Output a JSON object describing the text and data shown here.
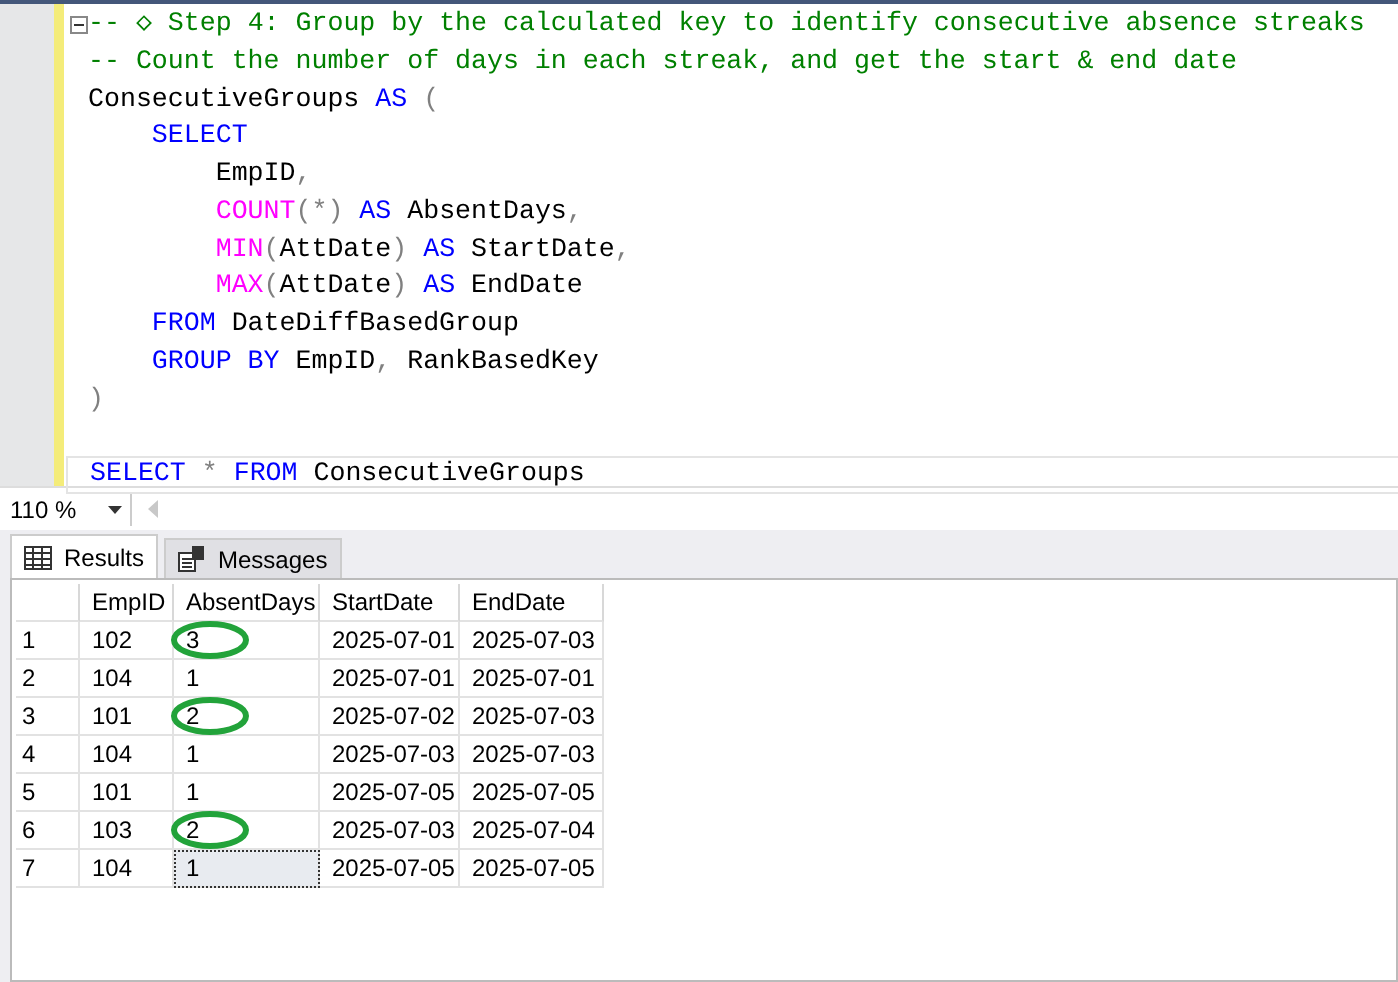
{
  "editor": {
    "lines": [
      {
        "collapsible": true,
        "tokens": [
          {
            "kind": "comment",
            "text": "-- ◇ Step 4: Group by the calculated key to identify consecutive absence streaks"
          }
        ]
      },
      {
        "collapsible": false,
        "tokens": [
          {
            "kind": "comment",
            "text": "-- Count the number of days in each streak, and get the start & end date"
          }
        ]
      },
      {
        "collapsible": false,
        "tokens": [
          {
            "kind": "plain",
            "text": "ConsecutiveGroups "
          },
          {
            "kind": "keyword",
            "text": "AS"
          },
          {
            "kind": "punct",
            "text": " ("
          }
        ]
      },
      {
        "collapsible": false,
        "tokens": [
          {
            "kind": "keyword",
            "text": "    SELECT"
          }
        ]
      },
      {
        "collapsible": false,
        "tokens": [
          {
            "kind": "plain",
            "text": "        EmpID"
          },
          {
            "kind": "punct",
            "text": ","
          }
        ]
      },
      {
        "collapsible": false,
        "tokens": [
          {
            "kind": "function",
            "text": "        COUNT"
          },
          {
            "kind": "punct",
            "text": "(*)"
          },
          {
            "kind": "keyword",
            "text": " AS"
          },
          {
            "kind": "plain",
            "text": " AbsentDays"
          },
          {
            "kind": "punct",
            "text": ","
          }
        ]
      },
      {
        "collapsible": false,
        "tokens": [
          {
            "kind": "function",
            "text": "        MIN"
          },
          {
            "kind": "punct",
            "text": "("
          },
          {
            "kind": "plain",
            "text": "AttDate"
          },
          {
            "kind": "punct",
            "text": ")"
          },
          {
            "kind": "keyword",
            "text": " AS"
          },
          {
            "kind": "plain",
            "text": " StartDate"
          },
          {
            "kind": "punct",
            "text": ","
          }
        ]
      },
      {
        "collapsible": false,
        "tokens": [
          {
            "kind": "function",
            "text": "        MAX"
          },
          {
            "kind": "punct",
            "text": "("
          },
          {
            "kind": "plain",
            "text": "AttDate"
          },
          {
            "kind": "punct",
            "text": ")"
          },
          {
            "kind": "keyword",
            "text": " AS"
          },
          {
            "kind": "plain",
            "text": " EndDate"
          }
        ]
      },
      {
        "collapsible": false,
        "tokens": [
          {
            "kind": "keyword",
            "text": "    FROM"
          },
          {
            "kind": "plain",
            "text": " DateDiffBasedGroup"
          }
        ]
      },
      {
        "collapsible": false,
        "tokens": [
          {
            "kind": "keyword",
            "text": "    GROUP BY"
          },
          {
            "kind": "plain",
            "text": " EmpID"
          },
          {
            "kind": "punct",
            "text": ","
          },
          {
            "kind": "plain",
            "text": " RankBasedKey"
          }
        ]
      },
      {
        "collapsible": false,
        "tokens": [
          {
            "kind": "punct",
            "text": ")"
          }
        ]
      }
    ],
    "current_line": {
      "tokens": [
        {
          "kind": "keyword",
          "text": "SELECT"
        },
        {
          "kind": "punct",
          "text": " *"
        },
        {
          "kind": "keyword",
          "text": " FROM"
        },
        {
          "kind": "plain",
          "text": " ConsecutiveGroups"
        }
      ]
    }
  },
  "zoom": {
    "value": "110 %"
  },
  "tabs": [
    {
      "label": "Results",
      "selected": true,
      "kind": "grid"
    },
    {
      "label": "Messages",
      "selected": false,
      "kind": "messages"
    }
  ],
  "table": {
    "columns": [
      "EmpID",
      "AbsentDays",
      "StartDate",
      "EndDate"
    ],
    "rows": [
      {
        "number": "1",
        "cells": [
          "102",
          "3",
          "2025-07-01",
          "2025-07-03"
        ],
        "circled": true,
        "selected": false
      },
      {
        "number": "2",
        "cells": [
          "104",
          "1",
          "2025-07-01",
          "2025-07-01"
        ],
        "circled": false,
        "selected": false
      },
      {
        "number": "3",
        "cells": [
          "101",
          "2",
          "2025-07-02",
          "2025-07-03"
        ],
        "circled": true,
        "selected": false
      },
      {
        "number": "4",
        "cells": [
          "104",
          "1",
          "2025-07-03",
          "2025-07-03"
        ],
        "circled": false,
        "selected": false
      },
      {
        "number": "5",
        "cells": [
          "101",
          "1",
          "2025-07-05",
          "2025-07-05"
        ],
        "circled": false,
        "selected": false
      },
      {
        "number": "6",
        "cells": [
          "103",
          "2",
          "2025-07-03",
          "2025-07-04"
        ],
        "circled": true,
        "selected": false
      },
      {
        "number": "7",
        "cells": [
          "104",
          "1",
          "2025-07-05",
          "2025-07-05"
        ],
        "circled": false,
        "selected": true
      }
    ]
  }
}
